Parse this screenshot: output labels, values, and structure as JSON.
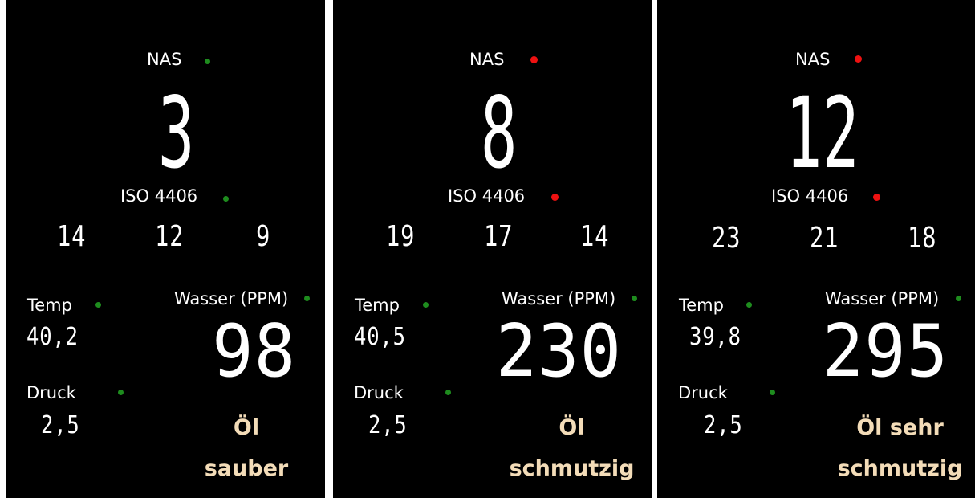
{
  "colors": {
    "ok": "#1e8c1e",
    "alarm": "#ee1111",
    "status_text": "#f3dcb8",
    "background": "#000000"
  },
  "labels": {
    "nas": "NAS",
    "iso": "ISO 4406",
    "temp": "Temp",
    "water": "Wasser (PPM)",
    "pressure": "Druck"
  },
  "panels": [
    {
      "nas_value": "3",
      "nas_indicator": "green",
      "iso_indicator": "green",
      "iso_codes": [
        "14",
        "12",
        "9"
      ],
      "temp": "40,2",
      "temp_indicator": "green",
      "water": "98",
      "water_indicator": "green",
      "pressure": "2,5",
      "pressure_indicator": "green",
      "status_line1": "Öl",
      "status_line2": "sauber"
    },
    {
      "nas_value": "8",
      "nas_indicator": "red",
      "iso_indicator": "red",
      "iso_codes": [
        "19",
        "17",
        "14"
      ],
      "temp": "40,5",
      "temp_indicator": "green",
      "water": "230",
      "water_indicator": "green",
      "pressure": "2,5",
      "pressure_indicator": "green",
      "status_line1": "Öl",
      "status_line2": "schmutzig"
    },
    {
      "nas_value": "12",
      "nas_indicator": "red",
      "iso_indicator": "red",
      "iso_codes": [
        "23",
        "21",
        "18"
      ],
      "temp": "39,8",
      "temp_indicator": "green",
      "water": "295",
      "water_indicator": "green",
      "pressure": "2,5",
      "pressure_indicator": "green",
      "status_line1": "Öl sehr",
      "status_line2": "schmutzig"
    }
  ]
}
